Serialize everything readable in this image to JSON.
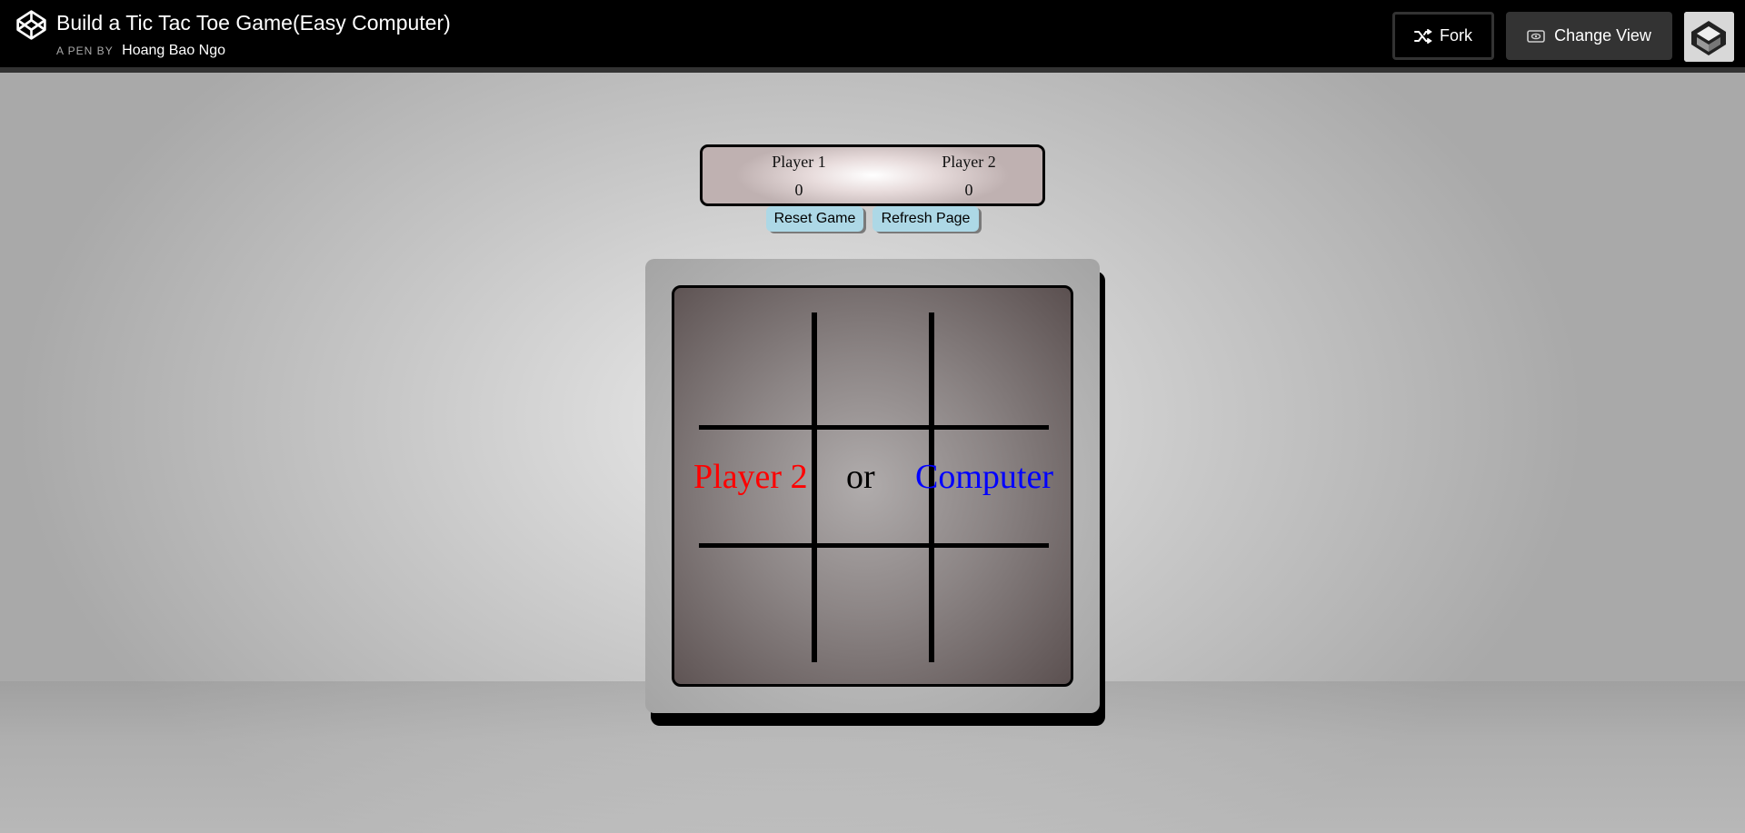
{
  "header": {
    "title": "Build a Tic Tac Toe Game(Easy Computer)",
    "byline_prefix": "A PEN BY",
    "author": "Hoang Bao Ngo",
    "fork_label": "Fork",
    "change_view_label": "Change View"
  },
  "scoreboard": {
    "player1_label": "Player 1",
    "player1_score": "0",
    "player2_label": "Player 2",
    "player2_score": "0"
  },
  "controls": {
    "reset_label": "Reset Game",
    "refresh_label": "Refresh Page"
  },
  "board": {
    "option_player2": "Player 2",
    "option_or": "or",
    "option_computer": "Computer"
  },
  "colors": {
    "player2_option": "#ff0000",
    "computer_option": "#0000ff",
    "button_bg": "#add8e6"
  },
  "icons": [
    "codepen-logo-icon",
    "fork-icon",
    "eye-icon",
    "avatar-icon"
  ]
}
